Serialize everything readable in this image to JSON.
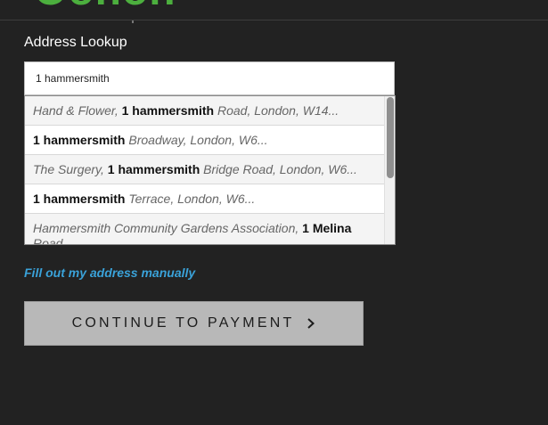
{
  "brand": {
    "logo_text": "Oonon",
    "logo_color": "#4caf3e"
  },
  "address_lookup": {
    "label": "Address Lookup",
    "input_value": "1 hammersmith",
    "results": [
      {
        "pre": "Hand & Flower, ",
        "match": "1 hammersmith",
        "post": " Road, London, W14..."
      },
      {
        "pre": "",
        "match": "1 hammersmith",
        "post": " Broadway, London, W6..."
      },
      {
        "pre": "The Surgery, ",
        "match": "1 hammersmith",
        "post": " Bridge Road, London, W6..."
      },
      {
        "pre": "",
        "match": "1 hammersmith",
        "post": " Terrace, London, W6..."
      },
      {
        "pre": "Hammersmith Community Gardens Association, ",
        "match": "1 Melina",
        "post": " Road..."
      }
    ]
  },
  "manual_link": {
    "label": "Fill out my address manually",
    "color": "#3aa2d9"
  },
  "continue_button": {
    "label": "CONTINUE TO PAYMENT",
    "icon": "chevron-right-icon"
  }
}
